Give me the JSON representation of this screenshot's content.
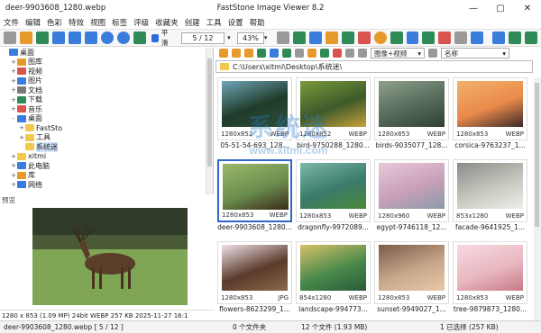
{
  "window": {
    "title_file": "deer-9903608_1280.webp",
    "title_app": "FastStone Image Viewer 8.2",
    "min": "—",
    "max": "▢",
    "close": "✕"
  },
  "menu": [
    "文件",
    "编辑",
    "色彩",
    "特效",
    "视图",
    "标签",
    "评级",
    "收藏夹",
    "创建",
    "工具",
    "设置",
    "帮助"
  ],
  "toolbar": {
    "smooth_label": "平滑",
    "page": "5 / 12",
    "zoom": "43%"
  },
  "tree": [
    {
      "label": "桌面",
      "indent": 0,
      "exp": "",
      "color": "#3b7ddd"
    },
    {
      "label": "图库",
      "indent": 1,
      "exp": "+",
      "color": "#e59a2b"
    },
    {
      "label": "视频",
      "indent": 1,
      "exp": "+",
      "color": "#d9534f"
    },
    {
      "label": "图片",
      "indent": 1,
      "exp": "+",
      "color": "#3b7ddd"
    },
    {
      "label": "文档",
      "indent": 1,
      "exp": "+",
      "color": "#7a7a7a"
    },
    {
      "label": "下载",
      "indent": 1,
      "exp": "+",
      "color": "#2e8b57"
    },
    {
      "label": "音乐",
      "indent": 1,
      "exp": "+",
      "color": "#d9534f"
    },
    {
      "label": "桌面",
      "indent": 1,
      "exp": "-",
      "color": "#3b7ddd"
    },
    {
      "label": "FastSto",
      "indent": 2,
      "exp": "+",
      "color": "#f2c94c"
    },
    {
      "label": "工具",
      "indent": 2,
      "exp": "+",
      "color": "#f2c94c"
    },
    {
      "label": "系统迷",
      "indent": 2,
      "exp": "",
      "color": "#f2c94c",
      "selected": true
    },
    {
      "label": "xitmi",
      "indent": 1,
      "exp": "+",
      "color": "#f2c94c"
    },
    {
      "label": "此电脑",
      "indent": 1,
      "exp": "+",
      "color": "#3b7ddd"
    },
    {
      "label": "库",
      "indent": 1,
      "exp": "+",
      "color": "#e59a2b"
    },
    {
      "label": "网络",
      "indent": 1,
      "exp": "+",
      "color": "#3b7ddd"
    }
  ],
  "preview_label": "预览",
  "preview_info": "1280 x 853 (1.09 MP)  24bit  WEBP   257 KB   2025-11-27 16:1",
  "address": "C:\\Users\\xitmi\\Desktop\\系统迷\\",
  "filter": "图像+视频",
  "sort": "名称",
  "thumbnails": [
    {
      "name": "05-51-54-693_128...",
      "dims": "1280x852",
      "fmt": "WEBP",
      "colors": [
        "#1f3b2a",
        "#6fa6b8",
        "#2c4f3a"
      ]
    },
    {
      "name": "bird-9750288_1280...",
      "dims": "1280x852",
      "fmt": "WEBP",
      "colors": [
        "#3d5a2a",
        "#7a9a3a",
        "#c9a23a"
      ]
    },
    {
      "name": "birds-9035077_128...",
      "dims": "1280x853",
      "fmt": "WEBP",
      "colors": [
        "#55695a",
        "#8fa08a",
        "#2f4030"
      ]
    },
    {
      "name": "corsica-9763237_1...",
      "dims": "1280x853",
      "fmt": "WEBP",
      "colors": [
        "#e98a4a",
        "#f2b36a",
        "#3a2a2a"
      ]
    },
    {
      "name": "deer-9903608_1280...",
      "dims": "1280x853",
      "fmt": "WEBP",
      "colors": [
        "#6b8e4e",
        "#9ab86a",
        "#3a2a1a"
      ],
      "active": true
    },
    {
      "name": "dragonfly-9972089...",
      "dims": "1280x853",
      "fmt": "WEBP",
      "colors": [
        "#3a7a6a",
        "#7ab8a8",
        "#4a8a3a"
      ]
    },
    {
      "name": "egypt-9746118_12...",
      "dims": "1280x960",
      "fmt": "WEBP",
      "colors": [
        "#c8a0b8",
        "#e8c8d8",
        "#8a9aa8"
      ]
    },
    {
      "name": "facade-9641925_1...",
      "dims": "853x1280",
      "fmt": "WEBP",
      "colors": [
        "#c8c8c0",
        "#8a8a88",
        "#eeeeea"
      ]
    },
    {
      "name": "flowers-8623299_1...",
      "dims": "1280x853",
      "fmt": "JPG",
      "colors": [
        "#5a3a2a",
        "#f0e0e8",
        "#8a6a4a"
      ]
    },
    {
      "name": "landscape-994773...",
      "dims": "854x1280",
      "fmt": "WEBP",
      "colors": [
        "#4a8a4a",
        "#d8c06a",
        "#2a5a3a"
      ]
    },
    {
      "name": "sunset-9949027_1...",
      "dims": "1280x853",
      "fmt": "WEBP",
      "colors": [
        "#c8a88a",
        "#7a5a4a",
        "#e8c8a8"
      ]
    },
    {
      "name": "tree-9879873_1280...",
      "dims": "1280x853",
      "fmt": "WEBP",
      "colors": [
        "#e8b8c0",
        "#f8d8e0",
        "#c87888"
      ]
    }
  ],
  "watermark": {
    "big": "系统迷",
    "small": "www.xitmi.com"
  },
  "status": {
    "file": "deer-9903608_1280.webp [ 5 / 12 ]",
    "folders": "0 个文件夹",
    "files": "12 个文件 (1.93 MB)",
    "selected": "1 已选择 (257 KB)"
  }
}
